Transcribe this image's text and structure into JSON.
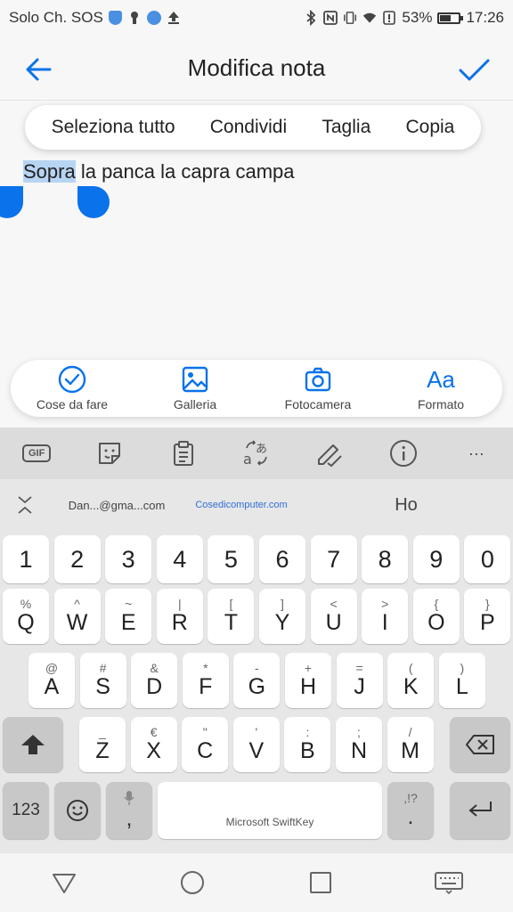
{
  "status": {
    "carrier": "Solo Ch. SOS",
    "battery": "53%",
    "battery_fraction": 0.53,
    "time": "17:26"
  },
  "header": {
    "title": "Modifica nota"
  },
  "context_menu": {
    "select_all": "Seleziona tutto",
    "share": "Condividi",
    "cut": "Taglia",
    "copy": "Copia"
  },
  "note": {
    "selected": "Sopra",
    "rest": " la panca la capra campa"
  },
  "quick_toolbar": {
    "todo": "Cose da fare",
    "gallery": "Galleria",
    "camera": "Fotocamera",
    "format_icon": "Aa",
    "format": "Formato"
  },
  "keyboard": {
    "toolbar": {
      "gif": "GIF",
      "more": "···"
    },
    "suggestions": [
      "Dan...@gma...com",
      "Cosedicomputer.com",
      "Ho"
    ],
    "numbers": [
      "1",
      "2",
      "3",
      "4",
      "5",
      "6",
      "7",
      "8",
      "9",
      "0"
    ],
    "row1": [
      {
        "sub": "%",
        "main": "Q"
      },
      {
        "sub": "^",
        "main": "W"
      },
      {
        "sub": "~",
        "main": "E"
      },
      {
        "sub": "|",
        "main": "R"
      },
      {
        "sub": "[",
        "main": "T"
      },
      {
        "sub": "]",
        "main": "Y"
      },
      {
        "sub": "<",
        "main": "U"
      },
      {
        "sub": ">",
        "main": "I"
      },
      {
        "sub": "{",
        "main": "O"
      },
      {
        "sub": "}",
        "main": "P"
      }
    ],
    "row2": [
      {
        "sub": "@",
        "main": "A"
      },
      {
        "sub": "#",
        "main": "S"
      },
      {
        "sub": "&",
        "main": "D"
      },
      {
        "sub": "*",
        "main": "F"
      },
      {
        "sub": "-",
        "main": "G"
      },
      {
        "sub": "+",
        "main": "H"
      },
      {
        "sub": "=",
        "main": "J"
      },
      {
        "sub": "(",
        "main": "K"
      },
      {
        "sub": ")",
        "main": "L"
      }
    ],
    "row3": [
      {
        "sub": "_",
        "main": "Z"
      },
      {
        "sub": "€",
        "main": "X"
      },
      {
        "sub": "\"",
        "main": "C"
      },
      {
        "sub": "'",
        "main": "V"
      },
      {
        "sub": ":",
        "main": "B"
      },
      {
        "sub": ";",
        "main": "N"
      },
      {
        "sub": "/",
        "main": "M"
      }
    ],
    "num_toggle": "123",
    "comma": ",",
    "space_label": "Microsoft SwiftKey",
    "period_sub": ",!?",
    "period": "."
  },
  "colors": {
    "accent": "#0a72ea",
    "selection": "#b7d4f3"
  }
}
